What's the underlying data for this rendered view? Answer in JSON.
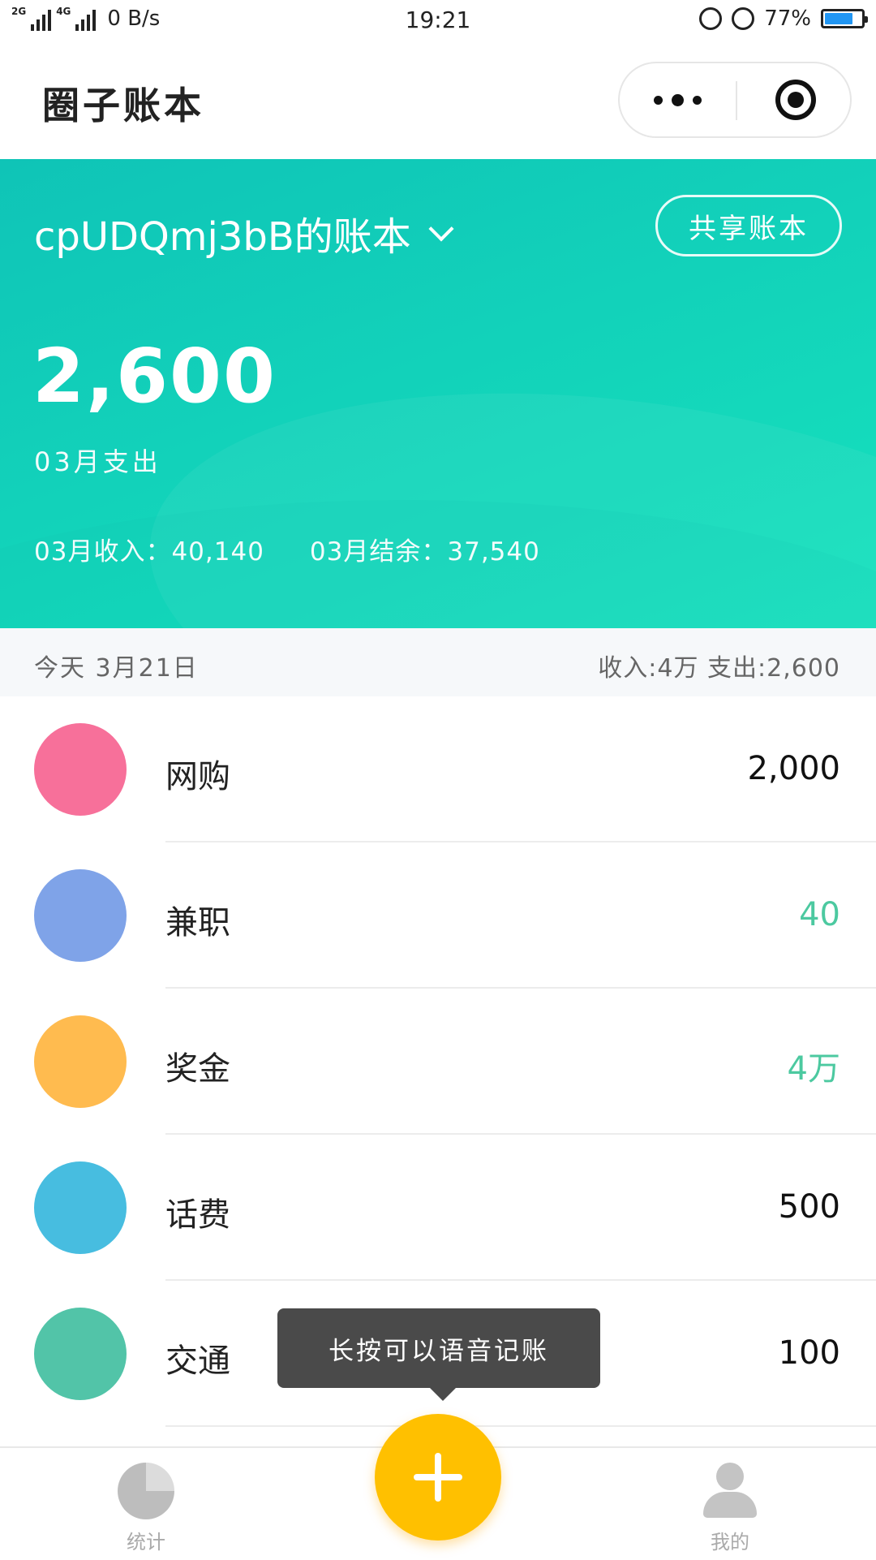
{
  "status_bar": {
    "net1": "2G",
    "net2": "4G",
    "speed": "0 B/s",
    "time": "19:21",
    "battery": "77%",
    "battery_level": 0.77
  },
  "header": {
    "title": "圈子账本",
    "more_icon": "more-dots-icon",
    "close_icon": "target-circle-icon"
  },
  "hero": {
    "book_name": "cpUDQmj3bB的账本",
    "share_label": "共享账本",
    "amount": "2,600",
    "amount_label": "03月支出",
    "income_text": "03月收入：40,140",
    "balance_text": "03月结余：37,540",
    "gradient_start": "#0fc4b7",
    "gradient_end": "#16e2bd"
  },
  "date_row": {
    "date": "今天 3月21日",
    "summary": "收入:4万 支出:2,600"
  },
  "records": [
    {
      "name": "网购",
      "amount": "2,000",
      "type": "expense",
      "color": "#f7709a"
    },
    {
      "name": "兼职",
      "amount": "40",
      "type": "income",
      "color": "#7fa3e8"
    },
    {
      "name": "奖金",
      "amount": "4万",
      "type": "income",
      "color": "#ffbb4f"
    },
    {
      "name": "话费",
      "amount": "500",
      "type": "expense",
      "color": "#47bde0"
    },
    {
      "name": "交通",
      "amount": "100",
      "type": "expense",
      "color": "#52c4a8"
    }
  ],
  "tooltip": "长按可以语音记账",
  "tabbar": {
    "stats_label": "统计",
    "me_label": "我的",
    "add_color": "#ffc000"
  }
}
